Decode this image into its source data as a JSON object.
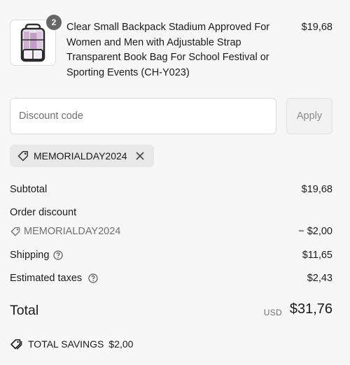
{
  "product": {
    "name": "Clear Small Backpack Stadium Approved For Women and Men with Adjustable Strap Transparent Book Bag For School Festival or Sporting Events (CH-Y023)",
    "price": "$19,68",
    "quantity": "2"
  },
  "discount": {
    "placeholder": "Discount code",
    "apply_label": "Apply",
    "applied_code": "MEMORIALDAY2024"
  },
  "summary": {
    "subtotal_label": "Subtotal",
    "subtotal_value": "$19,68",
    "order_discount_label": "Order discount",
    "order_discount_code": "MEMORIALDAY2024",
    "order_discount_value": "− $2,00",
    "shipping_label": "Shipping",
    "shipping_value": "$11,65",
    "taxes_label": "Estimated taxes",
    "taxes_value": "$2,43",
    "total_label": "Total",
    "total_currency": "USD",
    "total_value": "$31,76",
    "savings_label": "TOTAL SAVINGS",
    "savings_value": "$2,00"
  }
}
